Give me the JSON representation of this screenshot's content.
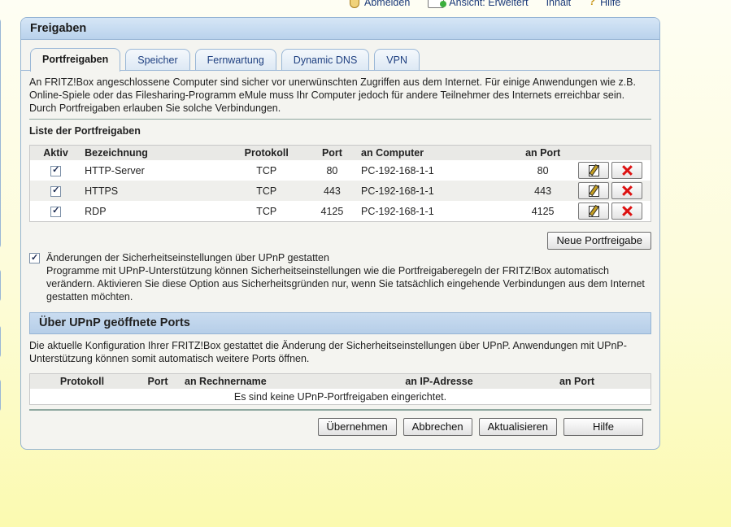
{
  "toolbar": {
    "logout": "Abmelden",
    "view": "Ansicht: Erweitert",
    "content": "Inhalt",
    "help": "Hilfe"
  },
  "panel": {
    "title": "Freigaben",
    "tabs": [
      {
        "label": "Portfreigaben",
        "active": true
      },
      {
        "label": "Speicher"
      },
      {
        "label": "Fernwartung"
      },
      {
        "label": "Dynamic DNS"
      },
      {
        "label": "VPN"
      }
    ],
    "intro": "An FRITZ!Box angeschlossene Computer sind sicher vor unerwünschten Zugriffen aus dem Internet. Für einige Anwendungen wie z.B. Online-Spiele oder das Filesharing-Programm eMule muss Ihr Computer jedoch für andere Teilnehmer des Internets erreichbar sein. Durch Portfreigaben erlauben Sie solche Verbindungen.",
    "list_title": "Liste der Portfreigaben",
    "table": {
      "headers": [
        "Aktiv",
        "Bezeichnung",
        "Protokoll",
        "Port",
        "an Computer",
        "an Port"
      ],
      "rows": [
        {
          "active": true,
          "name": "HTTP-Server",
          "protocol": "TCP",
          "port": "80",
          "computer": "PC-192-168-1-1",
          "to_port": "80"
        },
        {
          "active": true,
          "name": "HTTPS",
          "protocol": "TCP",
          "port": "443",
          "computer": "PC-192-168-1-1",
          "to_port": "443"
        },
        {
          "active": true,
          "name": "RDP",
          "protocol": "TCP",
          "port": "4125",
          "computer": "PC-192-168-1-1",
          "to_port": "4125"
        }
      ]
    },
    "new_button": "Neue Portfreigabe",
    "upnp_option": {
      "checked": true,
      "label": "Änderungen der Sicherheitseinstellungen über UPnP gestatten",
      "description": "Programme mit UPnP-Unterstützung können Sicherheitseinstellungen wie die Portfreigaberegeln der FRITZ!Box automatisch verändern. Aktivieren Sie diese Option aus Sicherheitsgründen nur, wenn Sie tatsächlich eingehende Verbindungen aus dem Internet gestatten möchten."
    },
    "upnp_section": {
      "title": "Über UPnP geöffnete Ports",
      "info": "Die aktuelle Konfiguration Ihrer FRITZ!Box gestattet die Änderung der Sicherheitseinstellungen über UPnP. Anwendungen mit UPnP-Unterstützung können somit automatisch weitere Ports öffnen.",
      "headers": [
        "Protokoll",
        "Port",
        "an Rechnername",
        "an IP-Adresse",
        "an Port"
      ],
      "empty": "Es sind keine UPnP-Portfreigaben eingerichtet."
    },
    "buttons": {
      "apply": "Übernehmen",
      "cancel": "Abbrechen",
      "refresh": "Aktualisieren",
      "help": "Hilfe"
    }
  }
}
